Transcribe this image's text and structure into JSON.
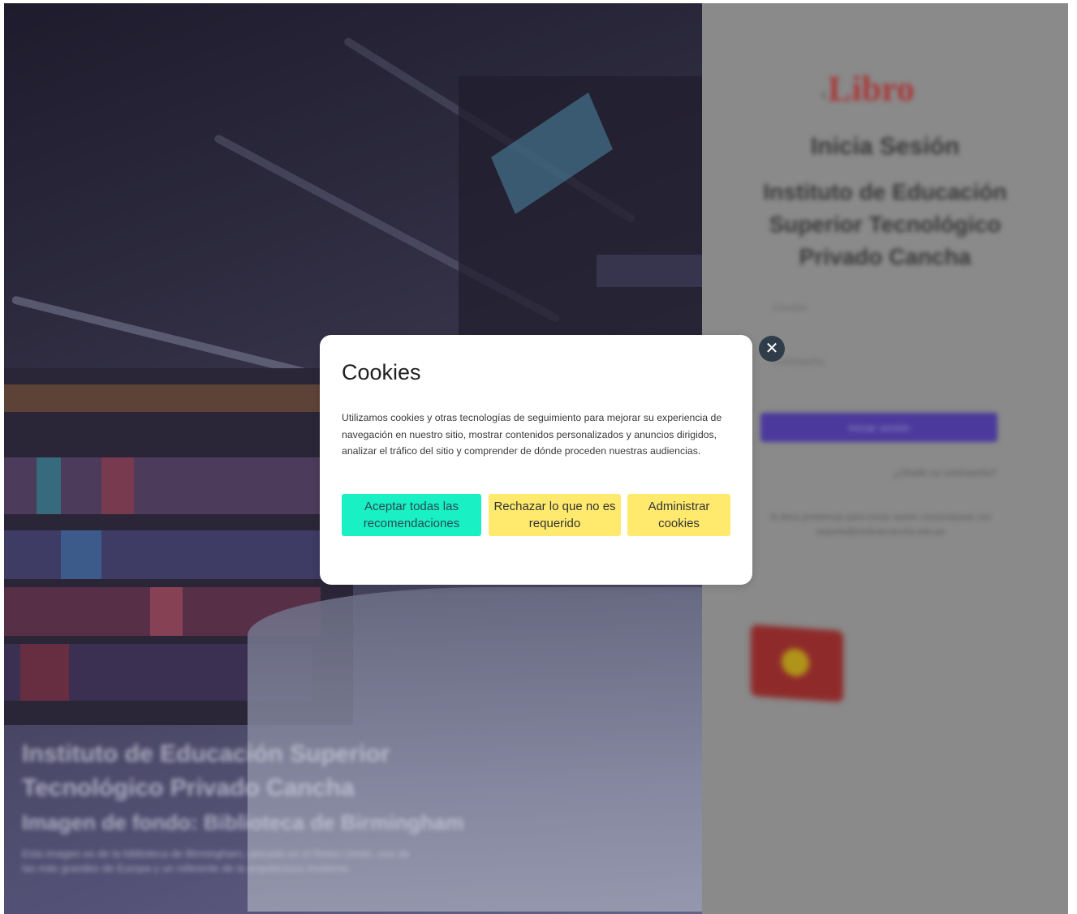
{
  "background": {
    "hero": {
      "title": "Instituto de Educación Superior Tecnológico Privado Cancha",
      "subtitle": "Imagen de fondo: Biblioteca de Birmingham",
      "description": "Esta imagen es de la biblioteca de Birmingham, ubicada en el Reino Unido, una de las más grandes de Europa y un referente de la arquitectura moderna."
    },
    "login": {
      "logo": "Libro",
      "title": "Inicia Sesión",
      "institution": "Instituto de Educación Superior Tecnológico Privado Cancha",
      "username_label": "Usuario",
      "password_label": "Contraseña",
      "login_button": "Iniciar sesión",
      "forgot_link": "¿Olvidó su contraseña?",
      "support_text": "Si tiene problemas para iniciar sesión comuníquese con soporte@institutocancha.edu.pe"
    }
  },
  "cookie_modal": {
    "title": "Cookies",
    "body": "Utilizamos cookies y otras tecnologías de seguimiento para mejorar su experiencia de navegación en nuestro sitio, mostrar contenidos personalizados y anuncios dirigidos, analizar el tráfico del sitio y comprender de dónde proceden nuestras audiencias.",
    "accept_label": "Aceptar todas las recomendaciones",
    "reject_label": "Rechazar lo que no es requerido",
    "manage_label": "Administrar cookies",
    "close_icon": "close-icon",
    "colors": {
      "accept_bg": "#19f0c3",
      "secondary_bg": "#ffea6e",
      "close_bg": "#2f3d4a"
    }
  }
}
